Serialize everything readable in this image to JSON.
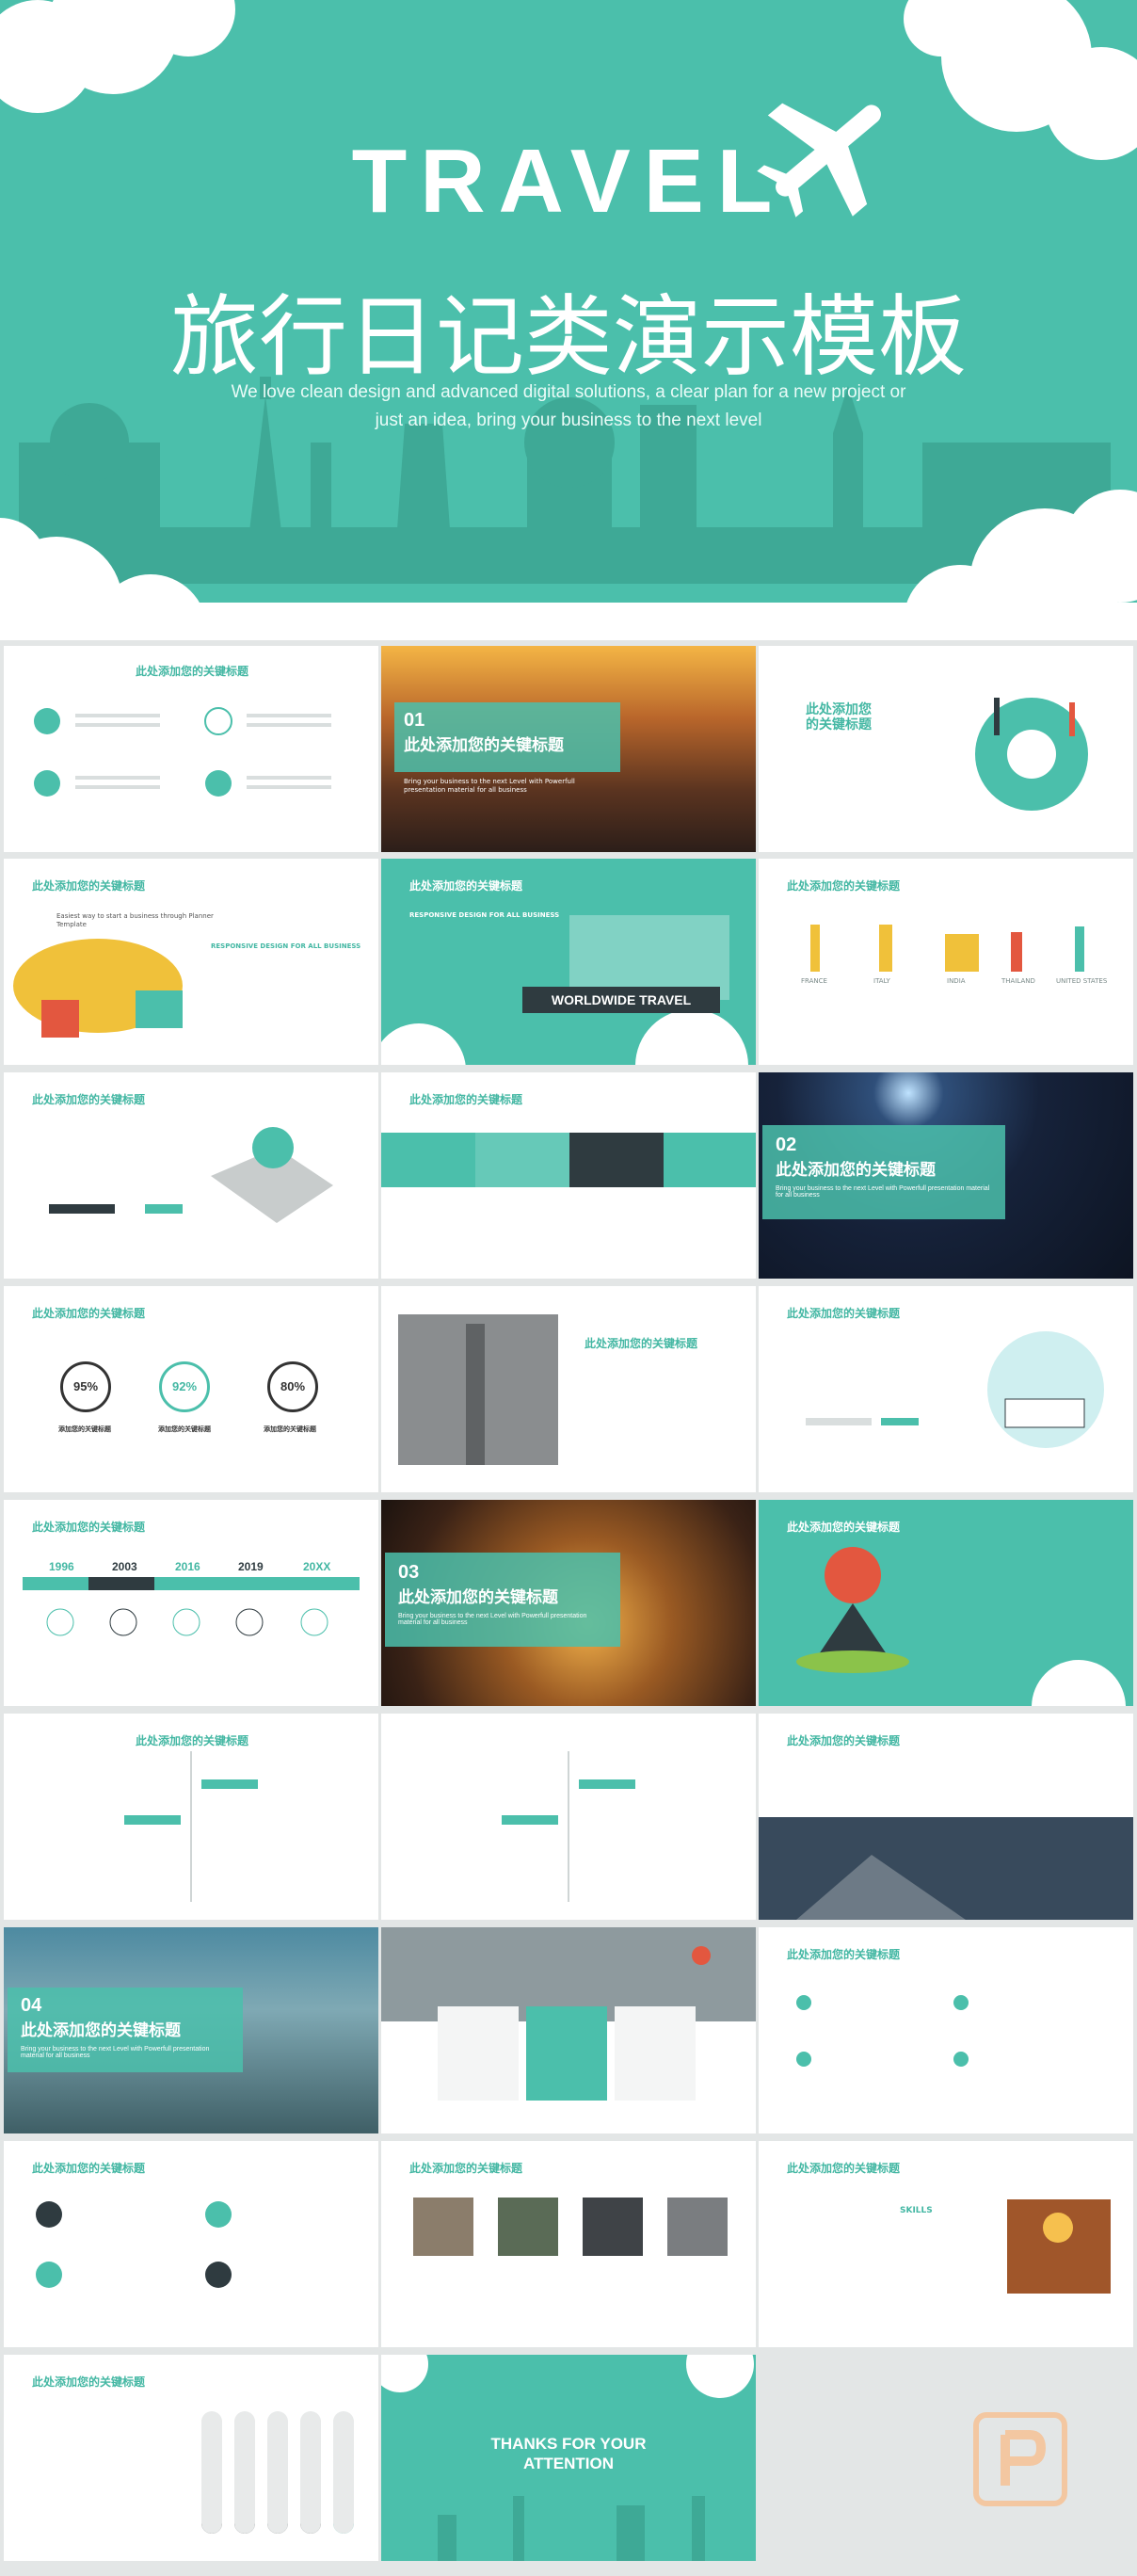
{
  "hero": {
    "title": "TRAVEL",
    "cn_title": "旅行日记类演示模板",
    "subtitle_line1": "We love clean design and advanced digital solutions, a clear plan for a new project or",
    "subtitle_line2": "just an idea, bring your business to the next level"
  },
  "slides": {
    "s2_title": "此处添加您的关键标题",
    "s3_num": "01",
    "s3_title": "此处添加您的关键标题",
    "s3_desc": "Bring your business to the next Level with Powerfull presentation material for all business",
    "s4_title": "此处添加您的关键标题",
    "s5_title": "此处添加您的关键标题",
    "s5_line": "Easiest way to start a business through Planner Template",
    "s5_sub": "RESPONSIVE DESIGN FOR ALL BUSINESS",
    "s6_title": "此处添加您的关键标题",
    "s6_sub": "RESPONSIVE DESIGN FOR ALL BUSINESS",
    "s6_banner": "WORLDWIDE TRAVEL",
    "s7_title": "此处添加您的关键标题",
    "s7_countries": [
      "FRANCE",
      "ITALY",
      "INDIA",
      "THAILAND",
      "UNITED STATES"
    ],
    "s8_title": "此处添加您的关键标题",
    "s9_title": "此处添加您的关键标题",
    "s10_num": "02",
    "s10_title": "此处添加您的关键标题",
    "s10_desc": "Bring your business to the next Level with Powerfull presentation material for all business",
    "s11_title": "此处添加您的关键标题",
    "s11_pcts": [
      "95%",
      "92%",
      "80%"
    ],
    "s11_label": "添加您的关键标题",
    "s12_title": "此处添加您的关键标题",
    "s13_title": "此处添加您的关键标题",
    "s14_title": "此处添加您的关键标题",
    "s14_years": [
      "1996",
      "2003",
      "2016",
      "2019",
      "20XX"
    ],
    "s15_num": "03",
    "s15_title": "此处添加您的关键标题",
    "s15_desc": "Bring your business to the next Level with Powerfull presentation material for all business",
    "s16_title": "此处添加您的关键标题",
    "s17_title": "此处添加您的关键标题",
    "s19_title": "此处添加您的关键标题",
    "s20_num": "04",
    "s20_title": "此处添加您的关键标题",
    "s20_desc": "Bring your business to the next Level with Powerfull presentation material for all business",
    "s22_title": "此处添加您的关键标题",
    "s23_title": "此处添加您的关键标题",
    "s24_title": "此处添加您的关键标题",
    "s25_title": "此处添加您的关键标题",
    "s25_skills": "SKILLS",
    "s26_title": "此处添加您的关键标题",
    "s27_line1": "THANKS FOR YOUR",
    "s27_line2": "ATTENTION"
  },
  "colors": {
    "accent": "#4bbfab",
    "dark": "#2f3b40",
    "background": "#e3e6e6"
  }
}
